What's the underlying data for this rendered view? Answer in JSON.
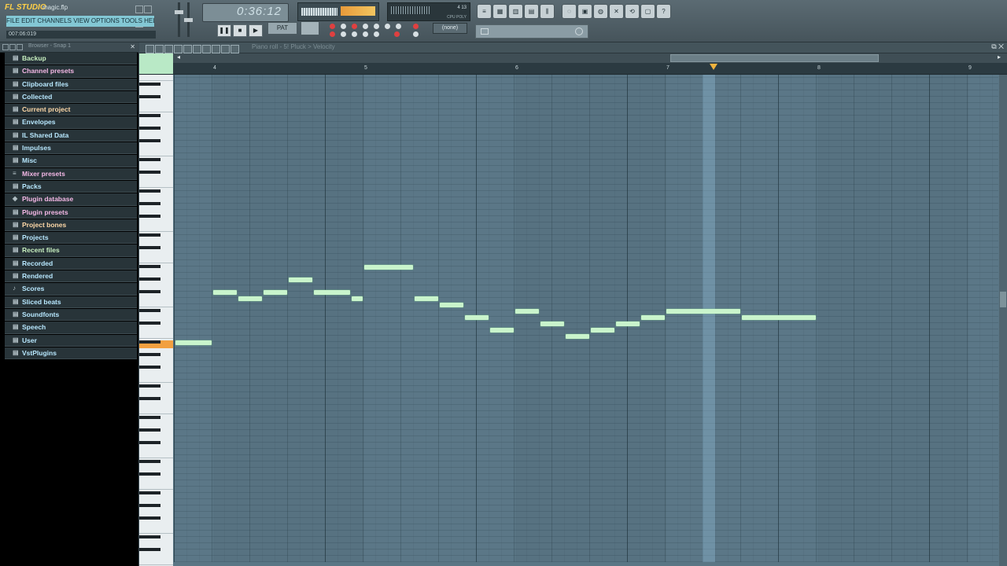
{
  "app": {
    "logo": "FL STUDIO",
    "project_name": "magic.flp",
    "hint_bar": "FILE EDIT CHANNELS VIEW OPTIONS TOOLS HELP",
    "time_code": "007:06:019"
  },
  "transport": {
    "lcd_time": "0:36:12",
    "pause_label": "❚❚",
    "stop_label": "■",
    "play_label": "▶",
    "pattern_label": "PAT",
    "snap_value": "(none)"
  },
  "cpu": {
    "readout": "4 13",
    "labels": "CPU POLY"
  },
  "browser": {
    "title": "Browser - Snap 1",
    "close_label": "✕",
    "items": [
      {
        "label": "Backup",
        "icon": "folder-icon",
        "color": "#c8f0c0"
      },
      {
        "label": "Channel presets",
        "icon": "folder-icon",
        "color": "#f4b8e6"
      },
      {
        "label": "Clipboard files",
        "icon": "folder-icon",
        "color": "#b8e8ff"
      },
      {
        "label": "Collected",
        "icon": "folder-icon",
        "color": "#b8e8ff"
      },
      {
        "label": "Current project",
        "icon": "folder-icon",
        "color": "#ffd9a8"
      },
      {
        "label": "Envelopes",
        "icon": "folder-icon",
        "color": "#b8e8ff"
      },
      {
        "label": "IL Shared Data",
        "icon": "folder-icon",
        "color": "#b8e8ff"
      },
      {
        "label": "Impulses",
        "icon": "folder-icon",
        "color": "#b8e8ff"
      },
      {
        "label": "Misc",
        "icon": "folder-icon",
        "color": "#b8e8ff"
      },
      {
        "label": "Mixer presets",
        "icon": "mixer-icon",
        "color": "#f4b8e6"
      },
      {
        "label": "Packs",
        "icon": "folder-icon",
        "color": "#b8e8ff"
      },
      {
        "label": "Plugin database",
        "icon": "plugin-icon",
        "color": "#f4b8e6"
      },
      {
        "label": "Plugin presets",
        "icon": "folder-icon",
        "color": "#f4b8e6"
      },
      {
        "label": "Project bones",
        "icon": "folder-icon",
        "color": "#ffd9a8"
      },
      {
        "label": "Projects",
        "icon": "folder-icon",
        "color": "#b8e8ff"
      },
      {
        "label": "Recent files",
        "icon": "folder-icon",
        "color": "#c8f0c0"
      },
      {
        "label": "Recorded",
        "icon": "folder-icon",
        "color": "#b8e8ff"
      },
      {
        "label": "Rendered",
        "icon": "folder-icon",
        "color": "#b8e8ff"
      },
      {
        "label": "Scores",
        "icon": "note-icon",
        "color": "#b8e8ff"
      },
      {
        "label": "Sliced beats",
        "icon": "folder-icon",
        "color": "#b8e8ff"
      },
      {
        "label": "Soundfonts",
        "icon": "folder-icon",
        "color": "#b8e8ff"
      },
      {
        "label": "Speech",
        "icon": "folder-icon",
        "color": "#b8e8ff"
      },
      {
        "label": "User",
        "icon": "folder-icon",
        "color": "#b8e8ff"
      },
      {
        "label": "VstPlugins",
        "icon": "folder-icon",
        "color": "#b8e8ff"
      }
    ]
  },
  "piano_roll": {
    "title": "Piano roll - 5! Pluck > Velocity",
    "bar_numbers": [
      "4",
      "5",
      "6",
      "7",
      "8",
      "9"
    ],
    "notes": [
      {
        "start": 3.75,
        "len": 0.25,
        "pitch": 22
      },
      {
        "start": 4.0,
        "len": 0.1667,
        "pitch": 30
      },
      {
        "start": 4.1667,
        "len": 0.1667,
        "pitch": 29
      },
      {
        "start": 4.3333,
        "len": 0.1667,
        "pitch": 30
      },
      {
        "start": 4.5,
        "len": 0.1667,
        "pitch": 32
      },
      {
        "start": 4.6667,
        "len": 0.25,
        "pitch": 30
      },
      {
        "start": 4.9167,
        "len": 0.0833,
        "pitch": 29
      },
      {
        "start": 5.0,
        "len": 0.3333,
        "pitch": 34
      },
      {
        "start": 5.3333,
        "len": 0.1667,
        "pitch": 29
      },
      {
        "start": 5.5,
        "len": 0.1667,
        "pitch": 28
      },
      {
        "start": 5.6667,
        "len": 0.1667,
        "pitch": 26
      },
      {
        "start": 5.8333,
        "len": 0.1667,
        "pitch": 24
      },
      {
        "start": 6.0,
        "len": 0.1667,
        "pitch": 27
      },
      {
        "start": 6.1667,
        "len": 0.1667,
        "pitch": 25
      },
      {
        "start": 6.3333,
        "len": 0.1667,
        "pitch": 23
      },
      {
        "start": 6.5,
        "len": 0.1667,
        "pitch": 24
      },
      {
        "start": 6.6667,
        "len": 0.1667,
        "pitch": 25
      },
      {
        "start": 6.8333,
        "len": 0.1667,
        "pitch": 26
      },
      {
        "start": 7.0,
        "len": 0.5,
        "pitch": 27
      },
      {
        "start": 7.5,
        "len": 0.5,
        "pitch": 26
      }
    ]
  },
  "colors": {
    "accent": "#f0b33e",
    "note": "#c9f4cc",
    "grid": "#5b7787"
  }
}
